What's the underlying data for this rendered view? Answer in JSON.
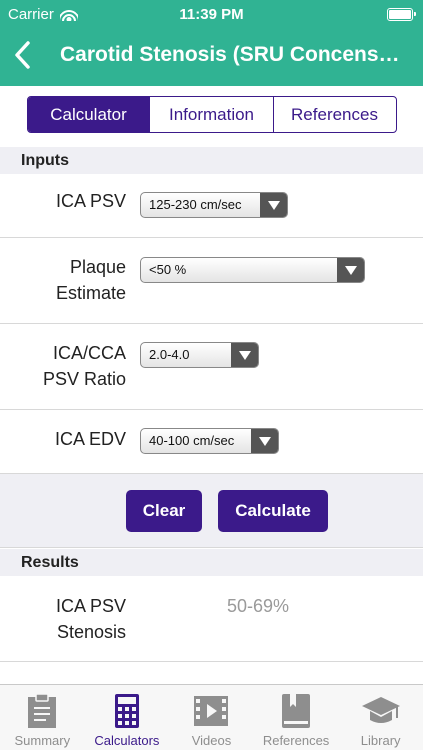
{
  "status_bar": {
    "carrier": "Carrier",
    "time": "11:39 PM"
  },
  "nav": {
    "title": "Carotid Stenosis (SRU Concens…"
  },
  "segments": [
    "Calculator",
    "Information",
    "References"
  ],
  "inputs": {
    "section_title": "Inputs",
    "fields": [
      {
        "label": "ICA PSV",
        "value": "125-230 cm/sec"
      },
      {
        "label_line1": "Plaque",
        "label_line2": "Estimate",
        "value": "<50 %"
      },
      {
        "label_line1": "ICA/CCA",
        "label_line2": "PSV Ratio",
        "value": "2.0-4.0"
      },
      {
        "label": "ICA EDV",
        "value": "40-100 cm/sec"
      }
    ]
  },
  "buttons": {
    "clear": "Clear",
    "calculate": "Calculate"
  },
  "results": {
    "section_title": "Results",
    "items": [
      {
        "label_line1": "ICA PSV",
        "label_line2": "Stenosis",
        "value": "50-69%"
      }
    ]
  },
  "tabs": [
    {
      "label": "Summary",
      "icon": "clipboard-icon",
      "active": false
    },
    {
      "label": "Calculators",
      "icon": "calculator-icon",
      "active": true
    },
    {
      "label": "Videos",
      "icon": "film-icon",
      "active": false
    },
    {
      "label": "References",
      "icon": "book-icon",
      "active": false
    },
    {
      "label": "Library",
      "icon": "graduation-cap-icon",
      "active": false
    }
  ],
  "colors": {
    "header": "#30b393",
    "accent": "#3b1a8a",
    "section_bg": "#efeff4",
    "result_text": "#9a9a9a"
  }
}
